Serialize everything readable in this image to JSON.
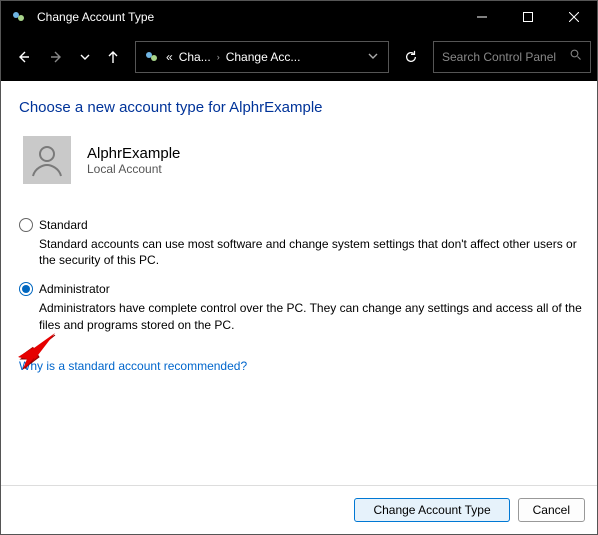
{
  "titlebar": {
    "title": "Change Account Type"
  },
  "navbar": {
    "segPrefix": "«",
    "seg1": "Cha...",
    "seg2": "Change Acc..."
  },
  "search": {
    "placeholder": "Search Control Panel"
  },
  "content": {
    "heading": "Choose a new account type for AlphrExample",
    "account": {
      "name": "AlphrExample",
      "sub": "Local Account"
    },
    "options": {
      "standard": {
        "label": "Standard",
        "desc": "Standard accounts can use most software and change system settings that don't affect other users or the security of this PC."
      },
      "admin": {
        "label": "Administrator",
        "desc": "Administrators have complete control over the PC. They can change any settings and access all of the files and programs stored on the PC."
      }
    },
    "link": "Why is a standard account recommended?"
  },
  "footer": {
    "primary": "Change Account Type",
    "cancel": "Cancel"
  }
}
